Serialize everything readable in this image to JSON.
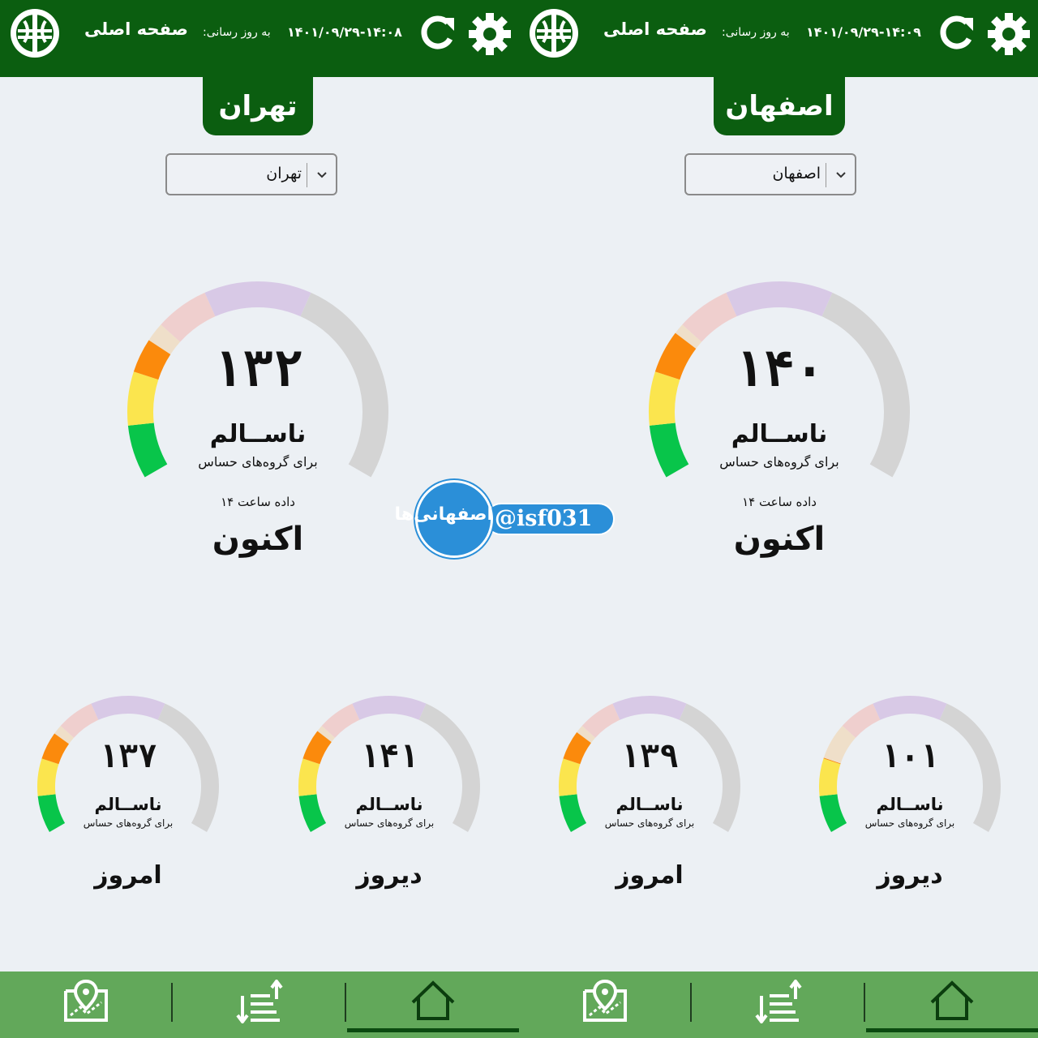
{
  "panels": [
    {
      "id": "left",
      "header": {
        "home_label": "صفحه اصلی",
        "update_label": "به روز رسانی:",
        "update_time": "۱۴۰۱/۰۹/۲۹-۱۴:۰۸"
      },
      "city_tab": "تهران",
      "city_select": {
        "value": "تهران"
      },
      "main_gauge": {
        "value": "۱۳۲",
        "status": "ناســالم",
        "sub": "برای گروه‌های حساس",
        "hour": "داده ساعت ۱۴",
        "label": "اکنون",
        "level": 132
      },
      "small_gauges": [
        {
          "value": "۱۳۷",
          "status": "ناســالم",
          "sub": "برای گروه‌های حساس",
          "label": "امروز",
          "level": 137
        },
        {
          "value": "۱۴۱",
          "status": "ناســالم",
          "sub": "برای گروه‌های حساس",
          "label": "دیروز",
          "level": 141
        }
      ]
    },
    {
      "id": "right",
      "header": {
        "home_label": "صفحه اصلی",
        "update_label": "به روز رسانی:",
        "update_time": "۱۴۰۱/۰۹/۲۹-۱۴:۰۹"
      },
      "city_tab": "اصفهان",
      "city_select": {
        "value": "اصفهان"
      },
      "main_gauge": {
        "value": "۱۴۰",
        "status": "ناســالم",
        "sub": "برای گروه‌های حساس",
        "hour": "داده ساعت ۱۴",
        "label": "اکنون",
        "level": 140
      },
      "small_gauges": [
        {
          "value": "۱۳۹",
          "status": "ناســالم",
          "sub": "برای گروه‌های حساس",
          "label": "امروز",
          "level": 139
        },
        {
          "value": "۱۰۱",
          "status": "ناســالم",
          "sub": "برای گروه‌های حساس",
          "label": "دیروز",
          "level": 101
        }
      ]
    }
  ],
  "gauge_scale": {
    "segments": [
      {
        "from": 0,
        "to": 50,
        "color": "#08c54a",
        "faded": "#a9e8b9"
      },
      {
        "from": 50,
        "to": 100,
        "color": "#fbe54e",
        "faded": "#f6efb2"
      },
      {
        "from": 100,
        "to": 150,
        "color": "#fb8a0c",
        "faded": "#efdfc9"
      },
      {
        "from": 150,
        "to": 200,
        "color": "#f08a8a",
        "faded": "#efcfce"
      },
      {
        "from": 200,
        "to": 300,
        "color": "#a889c9",
        "faded": "#d8c9e6"
      },
      {
        "from": 300,
        "to": 500,
        "color": "#a5a5a5",
        "faded": "#d4d4d4"
      }
    ]
  },
  "watermark": {
    "name": "اصفهانی‌ها",
    "handle": "@isf031"
  },
  "colors": {
    "header": "#0b5e10",
    "nav": "#62a85a",
    "accent": "#2b8fd8"
  },
  "icons": [
    "logo-icon",
    "refresh-icon",
    "gear-icon",
    "chevron-down-icon",
    "map-pin-icon",
    "sort-icon",
    "home-icon"
  ]
}
